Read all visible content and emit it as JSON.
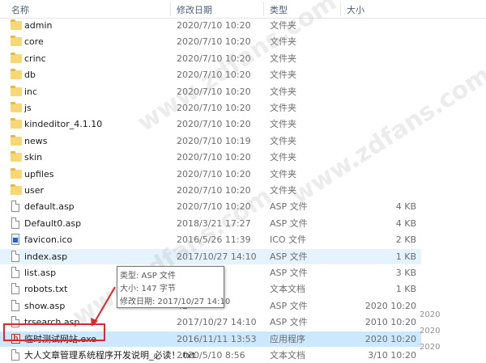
{
  "columns": {
    "name": "名称",
    "date": "修改日期",
    "type": "类型",
    "size": "大小"
  },
  "files": [
    {
      "icon": "folder-icon",
      "name": "admin",
      "date": "2020/7/10 10:20",
      "type": "文件夹",
      "size": ""
    },
    {
      "icon": "folder-icon",
      "name": "core",
      "date": "2020/7/10 10:20",
      "type": "文件夹",
      "size": ""
    },
    {
      "icon": "folder-icon",
      "name": "crinc",
      "date": "2020/7/10 10:20",
      "type": "文件夹",
      "size": ""
    },
    {
      "icon": "folder-icon",
      "name": "db",
      "date": "2020/7/10 10:20",
      "type": "文件夹",
      "size": ""
    },
    {
      "icon": "folder-icon",
      "name": "inc",
      "date": "2020/7/10 10:20",
      "type": "文件夹",
      "size": ""
    },
    {
      "icon": "folder-icon",
      "name": "js",
      "date": "2020/7/10 10:20",
      "type": "文件夹",
      "size": ""
    },
    {
      "icon": "folder-icon",
      "name": "kindeditor_4.1.10",
      "date": "2020/7/10 10:20",
      "type": "文件夹",
      "size": ""
    },
    {
      "icon": "folder-icon",
      "name": "news",
      "date": "2020/7/10 10:19",
      "type": "文件夹",
      "size": ""
    },
    {
      "icon": "folder-icon",
      "name": "skin",
      "date": "2020/7/10 10:20",
      "type": "文件夹",
      "size": ""
    },
    {
      "icon": "folder-icon",
      "name": "upfiles",
      "date": "2020/7/10 10:20",
      "type": "文件夹",
      "size": ""
    },
    {
      "icon": "folder-icon",
      "name": "user",
      "date": "2020/7/10 10:20",
      "type": "文件夹",
      "size": ""
    },
    {
      "icon": "document-icon",
      "name": "default.asp",
      "date": "2020/7/10 10:20",
      "type": "ASP 文件",
      "size": "4 KB"
    },
    {
      "icon": "document-icon",
      "name": "Default0.asp",
      "date": "2018/3/21 17:27",
      "type": "ASP 文件",
      "size": "4 KB"
    },
    {
      "icon": "image-icon",
      "name": "favicon.ico",
      "date": "2016/5/26 11:39",
      "type": "ICO 文件",
      "size": "2 KB"
    },
    {
      "icon": "document-icon",
      "name": "index.asp",
      "date": "2017/10/27 14:10",
      "type": "ASP 文件",
      "size": "1 KB"
    },
    {
      "icon": "document-icon",
      "name": "list.asp",
      "date": "43",
      "type": "ASP 文件",
      "size": "3 KB"
    },
    {
      "icon": "document-icon",
      "name": "robots.txt",
      "date": "08",
      "type": "文本文档",
      "size": "1 KB"
    },
    {
      "icon": "document-icon",
      "name": "show.asp",
      "date": "42",
      "type": "ASP 文件",
      "size": "2020 10:20"
    },
    {
      "icon": "document-icon",
      "name": "trsearch.asp",
      "date": "2017/10/27 14:10",
      "type": "ASP 文件",
      "size": "2010 10:20"
    },
    {
      "icon": "exe-icon",
      "name": "临时测试网站.exe",
      "date": "2016/11/11 13:53",
      "type": "应用程序",
      "size": "2020 10:20"
    },
    {
      "icon": "document-icon",
      "name": "大人文章管理系统程序开发说明_必读！.txt",
      "date": "2020/5/10 8:56",
      "type": "文本文档",
      "size": "3/10 10:20"
    }
  ],
  "tooltip": {
    "type": "类型: ASP 文件",
    "size": "大小: 147 字节",
    "date": "修改日期: 2017/10/27 14:10"
  },
  "ghost_text": [
    "2020",
    "2020",
    "2020"
  ],
  "watermark": [
    "www.zdfans.com",
    "www.zdfans.com",
    "www.zdfans.com"
  ],
  "colors": {
    "selection": "#cce8ff",
    "hover": "#e5f3ff",
    "highlight_box": "#e0262d",
    "folder": "#f8d775"
  }
}
